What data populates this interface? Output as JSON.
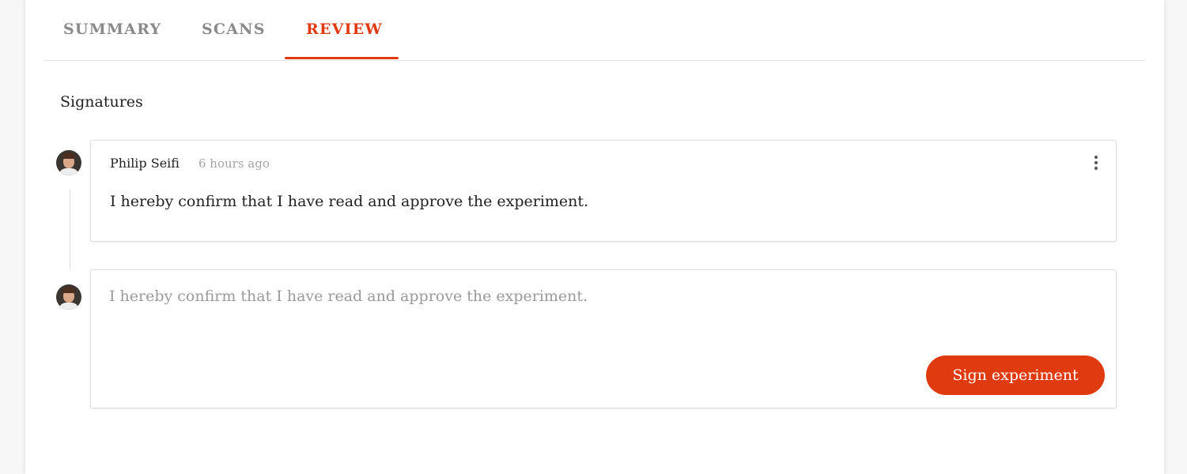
{
  "tabs": [
    {
      "label": "SUMMARY",
      "active": false
    },
    {
      "label": "SCANS",
      "active": false
    },
    {
      "label": "REVIEW",
      "active": true
    }
  ],
  "accent_color": "#e03a10",
  "signatures": {
    "title": "Signatures",
    "items": [
      {
        "author": "Philip Seifi",
        "time": "6 hours ago",
        "text": "I hereby confirm that I have read and approve the experiment.",
        "menu_icon": "kebab-menu-icon"
      }
    ],
    "compose": {
      "placeholder": "I hereby confirm that I have read and approve the experiment.",
      "value": "",
      "button_label": "Sign experiment"
    }
  }
}
